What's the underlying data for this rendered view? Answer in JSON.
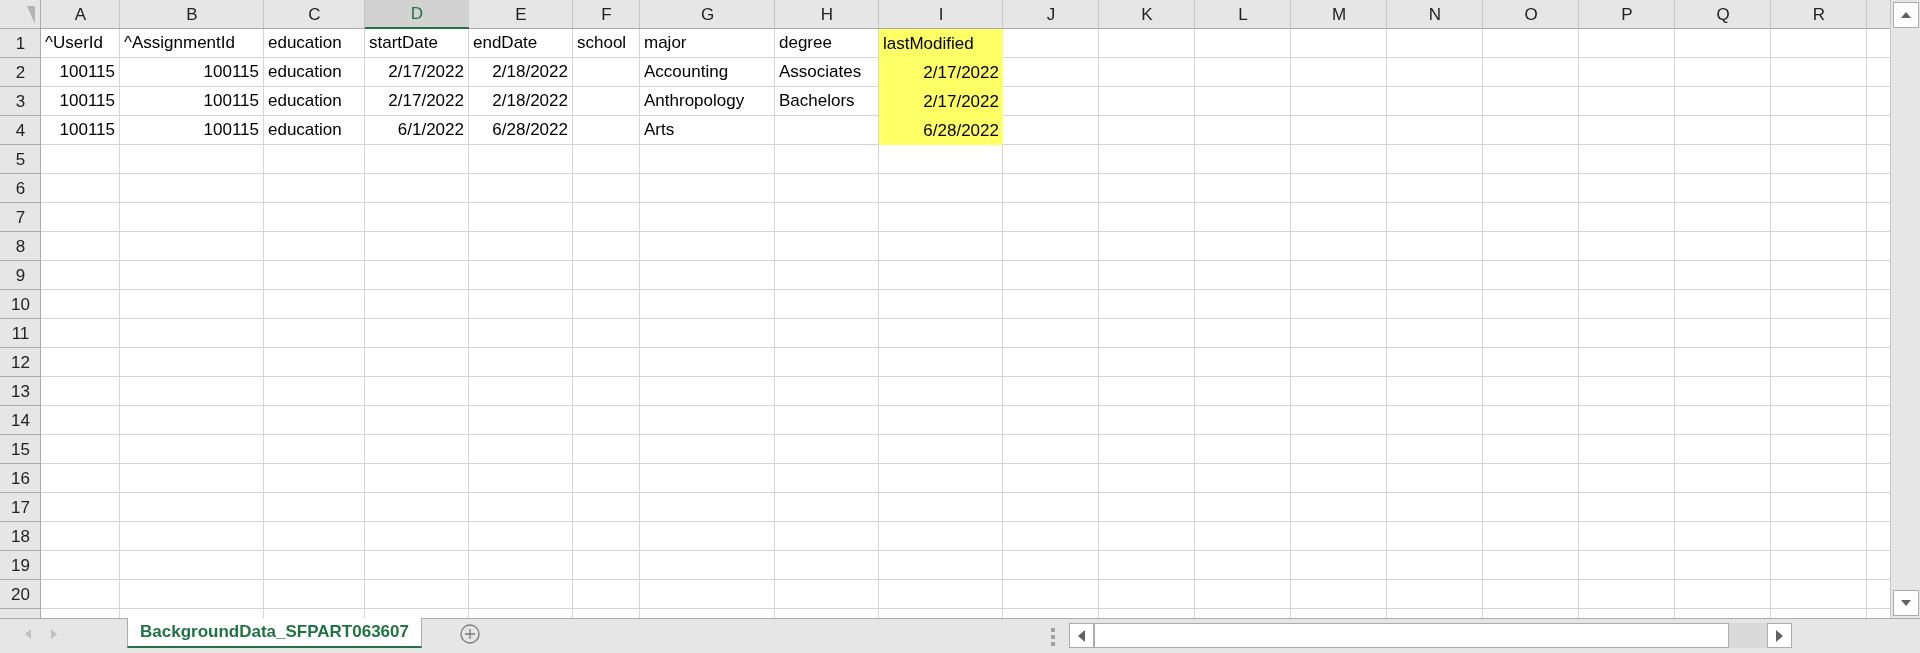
{
  "columns": [
    {
      "label": "A",
      "selected": false
    },
    {
      "label": "B",
      "selected": false
    },
    {
      "label": "C",
      "selected": false
    },
    {
      "label": "D",
      "selected": true
    },
    {
      "label": "E",
      "selected": false
    },
    {
      "label": "F",
      "selected": false
    },
    {
      "label": "G",
      "selected": false
    },
    {
      "label": "H",
      "selected": false
    },
    {
      "label": "I",
      "selected": false
    },
    {
      "label": "J",
      "selected": false
    },
    {
      "label": "K",
      "selected": false
    },
    {
      "label": "L",
      "selected": false
    },
    {
      "label": "M",
      "selected": false
    },
    {
      "label": "N",
      "selected": false
    },
    {
      "label": "O",
      "selected": false
    },
    {
      "label": "P",
      "selected": false
    },
    {
      "label": "Q",
      "selected": false
    },
    {
      "label": "R",
      "selected": false
    }
  ],
  "row_numbers": [
    "1",
    "2",
    "3",
    "4",
    "5",
    "6",
    "7",
    "8",
    "9",
    "10",
    "11",
    "12",
    "13",
    "14",
    "15",
    "16",
    "17",
    "18",
    "19",
    "20"
  ],
  "rows": [
    {
      "cells": [
        {
          "text": "^UserId",
          "kind": "text"
        },
        {
          "text": "^AssignmentId",
          "kind": "text"
        },
        {
          "text": "education",
          "kind": "text"
        },
        {
          "text": "startDate",
          "kind": "text"
        },
        {
          "text": "endDate",
          "kind": "text"
        },
        {
          "text": "school",
          "kind": "text"
        },
        {
          "text": "major",
          "kind": "text"
        },
        {
          "text": "degree",
          "kind": "text"
        },
        {
          "text": "lastModified",
          "kind": "text",
          "color": "#ffff66"
        }
      ]
    },
    {
      "cells": [
        {
          "text": "100115",
          "kind": "number"
        },
        {
          "text": "100115",
          "kind": "number"
        },
        {
          "text": "education",
          "kind": "text"
        },
        {
          "text": "2/17/2022",
          "kind": "number"
        },
        {
          "text": "2/18/2022",
          "kind": "number"
        },
        null,
        {
          "text": "Accounting",
          "kind": "text"
        },
        {
          "text": "Associates",
          "kind": "text"
        },
        {
          "text": "2/17/2022",
          "kind": "number",
          "color": "#ffff66"
        }
      ]
    },
    {
      "cells": [
        {
          "text": "100115",
          "kind": "number"
        },
        {
          "text": "100115",
          "kind": "number"
        },
        {
          "text": "education",
          "kind": "text"
        },
        {
          "text": "2/17/2022",
          "kind": "number"
        },
        {
          "text": "2/18/2022",
          "kind": "number"
        },
        null,
        {
          "text": "Anthropology",
          "kind": "text"
        },
        {
          "text": "Bachelors",
          "kind": "text"
        },
        {
          "text": "2/17/2022",
          "kind": "number",
          "color": "#ffff66"
        }
      ]
    },
    {
      "cells": [
        {
          "text": "100115",
          "kind": "number"
        },
        {
          "text": "100115",
          "kind": "number"
        },
        {
          "text": "education",
          "kind": "text"
        },
        {
          "text": "6/1/2022",
          "kind": "number"
        },
        {
          "text": "6/28/2022",
          "kind": "number"
        },
        null,
        {
          "text": "Arts",
          "kind": "text"
        },
        null,
        {
          "text": "6/28/2022",
          "kind": "number",
          "color": "#ffff66"
        }
      ]
    }
  ],
  "sheet_tabs": [
    {
      "label": "BackgroundData_SFPART063607",
      "selected": true
    }
  ]
}
